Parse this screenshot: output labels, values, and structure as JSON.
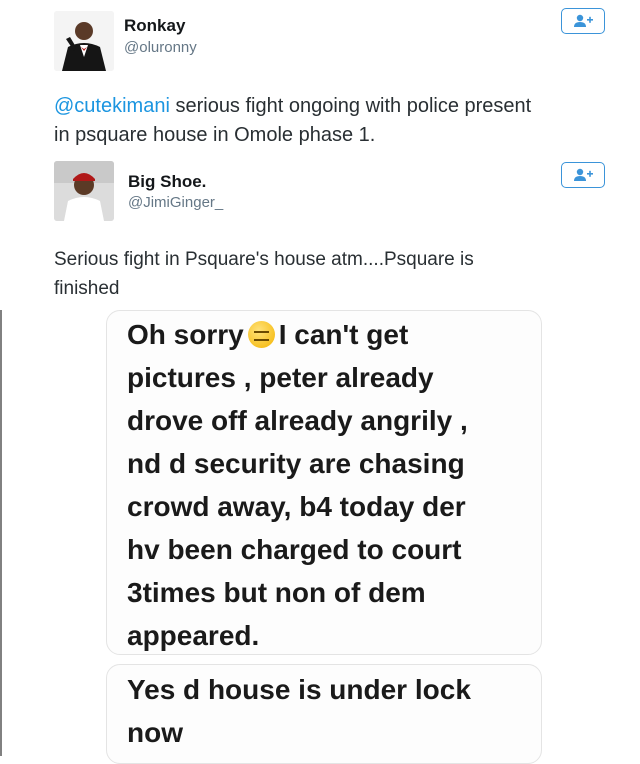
{
  "tweet1": {
    "name": "Ronkay",
    "handle": "@oluronny",
    "mention": "@cutekimani",
    "text": " serious fight ongoing with police present\nin psquare house in Omole phase 1.",
    "follow_icon": "add-user-icon"
  },
  "tweet2": {
    "name": "Big Shoe.",
    "handle": "@JimiGinger_",
    "text": "Serious fight in Psquare's house atm....Psquare is\nfinished",
    "follow_icon": "add-user-icon"
  },
  "chat": {
    "message1_part1": "Oh sorry",
    "emoji": "expressionless-face-emoji",
    "message1_part2": "I can't get\npictures , peter already\ndrove off already angrily ,\nnd d security are chasing\ncrowd away, b4 today der\nhv been charged to court\n3times but non of dem\nappeared.",
    "message2": "Yes d house is under lock\nnow"
  },
  "colors": {
    "accent": "#1b95e0",
    "button_border": "#3b94d9",
    "handle": "#657786"
  }
}
